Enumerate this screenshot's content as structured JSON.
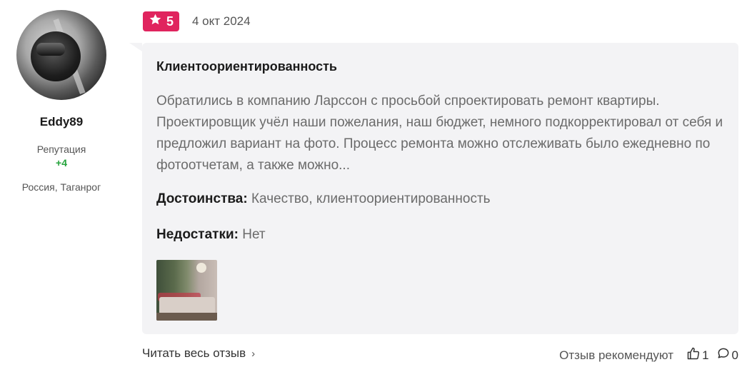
{
  "author": {
    "username": "Eddy89",
    "reputation_label": "Репутация",
    "reputation_value": "+4",
    "location": "Россия, Таганрог"
  },
  "review": {
    "rating": "5",
    "date": "4 окт 2024",
    "title": "Клиентоориентированность",
    "text": "Обратились в компанию Ларссон с просьбой спроектировать ремонт квартиры. Проектировщик учёл наши пожелания, наш бюджет, немного подкорректировал от себя и предложил вариант на фото. Процесс ремонта можно отслеживать было ежедневно по фотоотчетам, а также можно...",
    "pros_label": "Достоинства:",
    "pros_value": "Качество, клиентоориентированность",
    "cons_label": "Недостатки:",
    "cons_value": "Нет"
  },
  "footer": {
    "read_more": "Читать весь отзыв",
    "recommend": "Отзыв рекомендуют",
    "likes": "1",
    "comments": "0"
  },
  "colors": {
    "badge": "#e0245e",
    "reputation": "#25a33c",
    "card_bg": "#f3f3f5"
  },
  "icons": [
    "star-icon",
    "chevron-right-icon",
    "thumbs-up-icon",
    "comment-icon"
  ]
}
